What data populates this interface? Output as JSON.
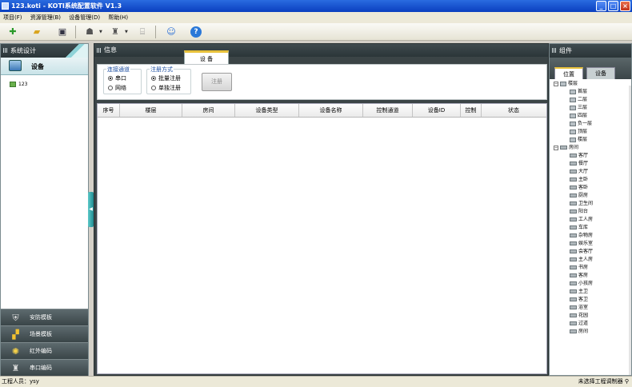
{
  "window": {
    "title": "123.koti - KOTI系统配置软件 V1.3"
  },
  "menu": [
    "项目(F)",
    "资源管理(B)",
    "设备管理(D)",
    "帮助(H)"
  ],
  "toolbar": {
    "icons": [
      "new-icon",
      "open-icon",
      "save-icon",
      "user-icon",
      "device-icon",
      "scan-icon",
      "person-icon",
      "help-icon"
    ]
  },
  "left": {
    "title": "系统设计",
    "device_label": "设备",
    "tree_node": "123",
    "modules": [
      "安防模板",
      "场景模板",
      "红外编码",
      "串口编码"
    ]
  },
  "center": {
    "title": "信息",
    "tab": "设 备",
    "conn_group_title": "连接通道",
    "conn_options": [
      "串口",
      "网络"
    ],
    "reg_group_title": "注册方式",
    "reg_options": [
      "批量注册",
      "单独注册"
    ],
    "register_button": "注册",
    "columns": [
      "序号",
      "楼层",
      "房间",
      "设备类型",
      "设备名称",
      "控制通道",
      "设备ID",
      "控制",
      "状态"
    ]
  },
  "right": {
    "title": "组件",
    "tabs": [
      "位置",
      "设备"
    ],
    "floor_root": "楼层",
    "floors": [
      "首层",
      "二层",
      "三层",
      "四层",
      "负一层",
      "顶层",
      "楼层"
    ],
    "room_root": "房间",
    "rooms": [
      "客厅",
      "餐厅",
      "大厅",
      "主卧",
      "客卧",
      "厨房",
      "卫生间",
      "阳台",
      "工人房",
      "车库",
      "杂物房",
      "娱乐室",
      "会客厅",
      "主人房",
      "书房",
      "客房",
      "小孩房",
      "主卫",
      "客卫",
      "浴室",
      "花园",
      "过道",
      "房间"
    ]
  },
  "status": {
    "left": "工程人员：ysy",
    "right": "未选择工程调制器"
  }
}
